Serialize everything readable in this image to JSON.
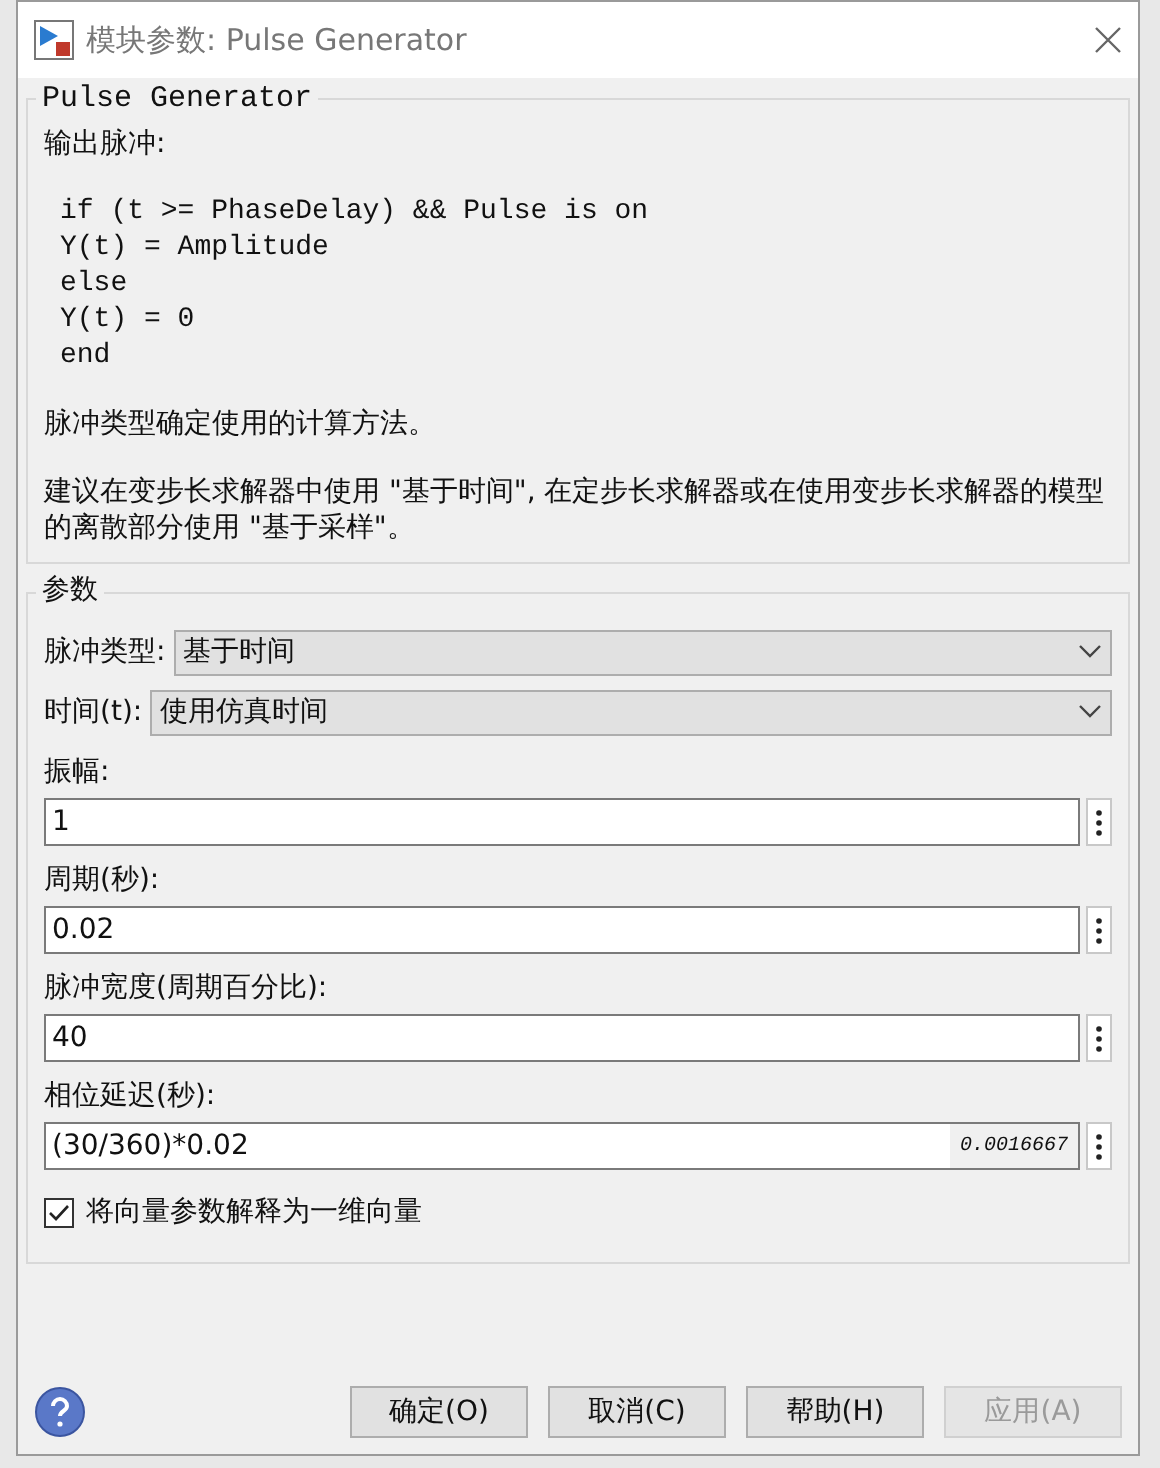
{
  "window": {
    "title": "模块参数: Pulse Generator"
  },
  "description": {
    "title": "Pulse Generator",
    "intro": "输出脉冲:",
    "code": [
      "if (t >= PhaseDelay) && Pulse is on",
      "Y(t) = Amplitude",
      "else",
      "Y(t) = 0",
      "end"
    ],
    "paragraphs": [
      "脉冲类型确定使用的计算方法。",
      "建议在变步长求解器中使用 \"基于时间\", 在定步长求解器或在使用变步长求解器的模型的离散部分使用 \"基于采样\"。"
    ]
  },
  "parameters": {
    "title": "参数",
    "items": [
      {
        "kind": "dropdown",
        "label": "脉冲类型:",
        "value": "基于时间"
      },
      {
        "kind": "dropdown",
        "label": "时间(t):",
        "value": "使用仿真时间"
      },
      {
        "kind": "edit",
        "label": "振幅:",
        "value": "1"
      },
      {
        "kind": "edit",
        "label": "周期(秒):",
        "value": "0.02"
      },
      {
        "kind": "edit",
        "label": "脉冲宽度(周期百分比):",
        "value": "40"
      },
      {
        "kind": "edit",
        "label": "相位延迟(秒):",
        "value": "(30/360)*0.02",
        "evaluated": "0.0016667"
      },
      {
        "kind": "checkbox",
        "label": "将向量参数解释为一维向量",
        "checked": true
      }
    ]
  },
  "buttons": [
    {
      "label": "确定(O)",
      "disabled": false
    },
    {
      "label": "取消(C)",
      "disabled": false
    },
    {
      "label": "帮助(H)",
      "disabled": false
    },
    {
      "label": "应用(A)",
      "disabled": true
    }
  ]
}
